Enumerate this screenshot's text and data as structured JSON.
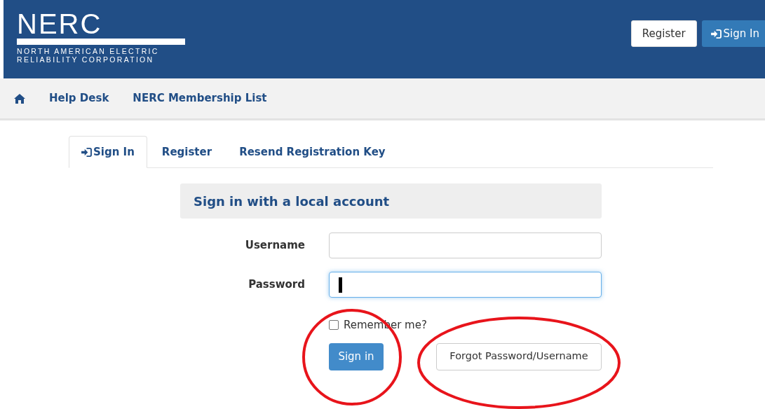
{
  "header": {
    "logo": {
      "name": "NERC",
      "line_1": "NORTH AMERICAN ELECTRIC",
      "line_2": "RELIABILITY CORPORATION"
    },
    "buttons": [
      {
        "label": "Register",
        "kind": "light"
      },
      {
        "label": "Sign In",
        "kind": "primary"
      }
    ]
  },
  "nav": {
    "items": [
      "Help Desk",
      "NERC Membership List"
    ]
  },
  "tabs": [
    {
      "label": "Sign In",
      "selected": true,
      "kind": "signin"
    },
    {
      "label": "Register",
      "selected": false,
      "kind": "plain"
    },
    {
      "label": "Resend Registration Key",
      "selected": false,
      "kind": "plain"
    }
  ],
  "form": {
    "heading": "Sign in with a local account",
    "fields": [
      {
        "label": "Username",
        "focused": false
      },
      {
        "label": "Password",
        "focused": true
      }
    ],
    "remember": {
      "label": "Remember me?",
      "checked": false
    },
    "submit": "Sign in",
    "forgot": "Forgot Password/Username"
  }
}
